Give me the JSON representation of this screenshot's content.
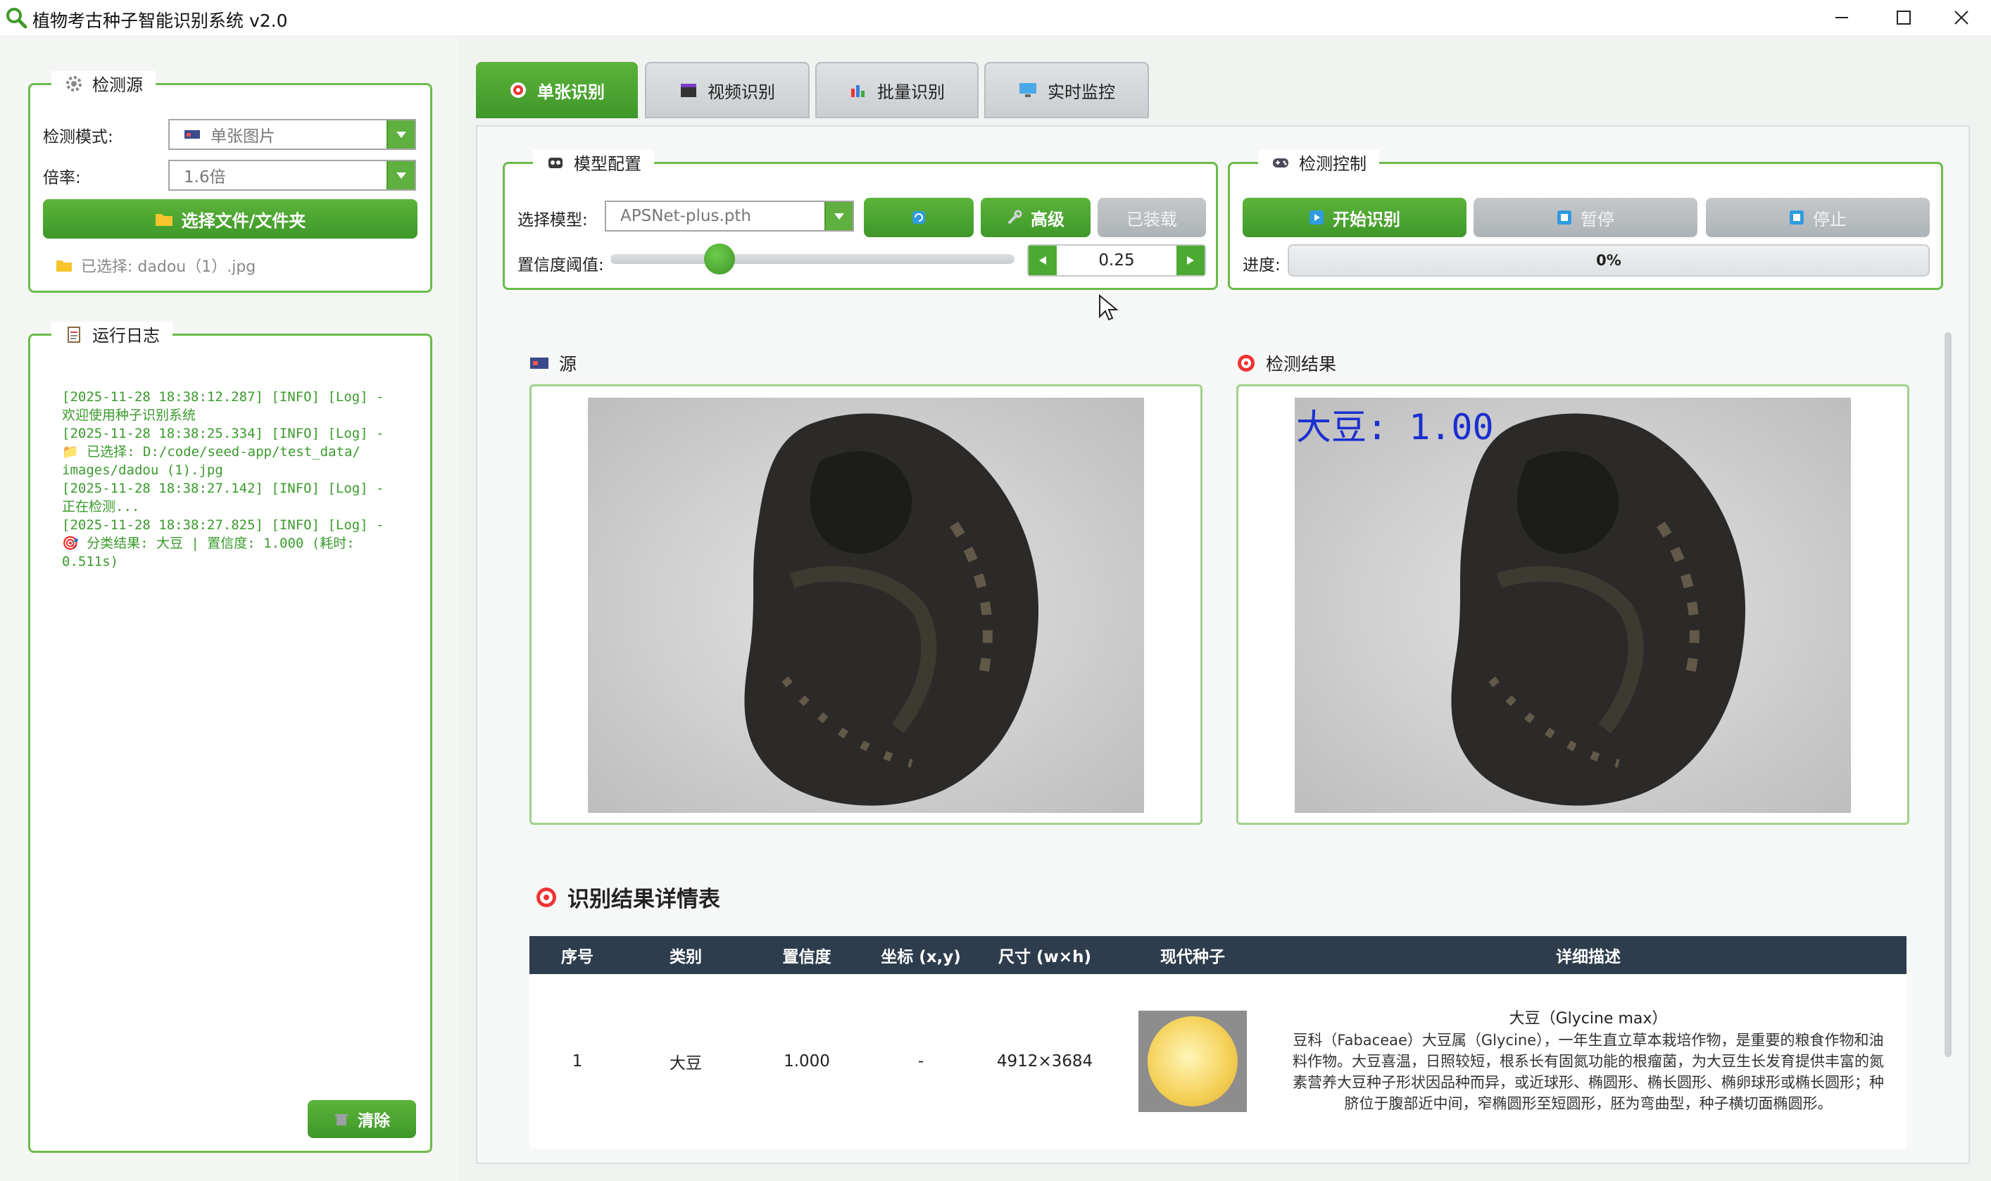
{
  "app": {
    "title": "植物考古种子智能识别系统 v2.0"
  },
  "source_panel": {
    "legend": "检测源",
    "mode_label": "检测模式:",
    "mode_value": "单张图片",
    "rate_label": "倍率:",
    "rate_value": "1.6倍",
    "select_button": "选择文件/文件夹",
    "selected_text": "已选择: dadou（1）.jpg"
  },
  "log_panel": {
    "legend": "运行日志",
    "lines": "[2025-11-28 18:38:12.287] [INFO] [Log] -\n欢迎使用种子识别系统\n[2025-11-28 18:38:25.334] [INFO] [Log] -\n📁 已选择: D:/code/seed-app/test_data/\nimages/dadou (1).jpg\n[2025-11-28 18:38:27.142] [INFO] [Log] -\n正在检测...\n[2025-11-28 18:38:27.825] [INFO] [Log] -\n🎯 分类结果: 大豆 | 置信度: 1.000 (耗时:\n0.511s)",
    "clear_button": "清除"
  },
  "tabs": [
    {
      "label": "单张识别"
    },
    {
      "label": "视频识别"
    },
    {
      "label": "批量识别"
    },
    {
      "label": "实时监控"
    }
  ],
  "model_panel": {
    "legend": "模型配置",
    "model_label": "选择模型:",
    "model_value": "APSNet-plus.pth",
    "advanced_button": "高级",
    "loaded_button": "已装载",
    "threshold_label": "置信度阈值:",
    "threshold_value": "0.25",
    "threshold": 0.25
  },
  "control_panel": {
    "legend": "检测控制",
    "start_button": "开始识别",
    "pause_button": "暂停",
    "stop_button": "停止",
    "progress_label": "进度:",
    "progress_text": "0%",
    "progress": 0
  },
  "images": {
    "source_title": "源",
    "result_title": "检测结果",
    "result_overlay": "大豆: 1.00"
  },
  "results": {
    "title": "识别结果详情表",
    "headers": [
      "序号",
      "类别",
      "置信度",
      "坐标 (x,y)",
      "尺寸 (w×h)",
      "现代种子",
      "详细描述"
    ],
    "rows": [
      {
        "index": "1",
        "category": "大豆",
        "confidence": "1.000",
        "coords": "-",
        "size": "4912×3684",
        "desc_title": "大豆（Glycine max）",
        "desc_body": "豆科（Fabaceae）大豆属（Glycine），一年生直立草本栽培作物，是重要的粮食作物和油料作物。大豆喜温，日照较短，根系长有固氮功能的根瘤菌，为大豆生长发育提供丰富的氮素营养大豆种子形状因品种而异，或近球形、椭圆形、椭长圆形、椭卵球形或椭长圆形；种脐位于腹部近中间，窄椭圆形至短圆形，胚为弯曲型，种子横切面椭圆形。"
      }
    ]
  },
  "colors": {
    "accent_green": "#4caa32",
    "panel_border": "#6cbb4a",
    "table_header": "#2e3d4e",
    "overlay_text": "#1a2fd0"
  }
}
